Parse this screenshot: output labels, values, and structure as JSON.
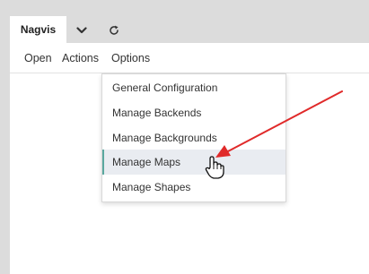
{
  "tabs": [
    {
      "label": "Nagvis"
    }
  ],
  "menubar": {
    "items": [
      "Open",
      "Actions",
      "Options"
    ]
  },
  "dropdown": {
    "items": [
      {
        "label": "General Configuration"
      },
      {
        "label": "Manage Backends"
      },
      {
        "label": "Manage Backgrounds"
      },
      {
        "label": "Manage Maps",
        "highlighted": true
      },
      {
        "label": "Manage Shapes"
      }
    ]
  },
  "colors": {
    "annotation_arrow": "#e02a2a",
    "highlight_bg": "#e9ecf1",
    "highlight_border": "#5aa89f",
    "chrome_bg": "#dcdcdc"
  },
  "icons": {
    "tab_menu": "chevron-down-icon",
    "refresh": "refresh-icon",
    "pointer": "hand-pointer-icon"
  }
}
